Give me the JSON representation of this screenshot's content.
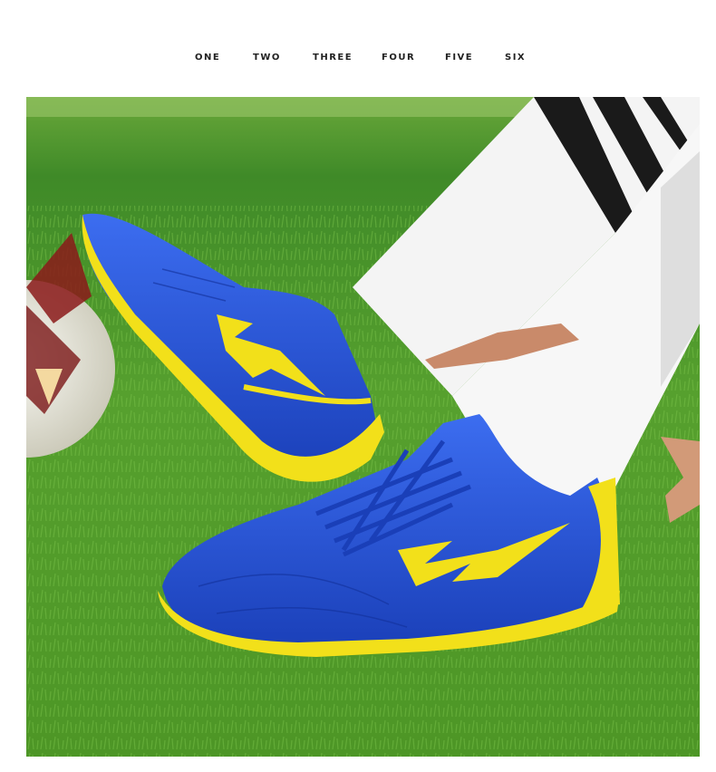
{
  "tabs": [
    {
      "label": "ONE"
    },
    {
      "label": "TWO"
    },
    {
      "label": "THREE"
    },
    {
      "label": "FOUR"
    },
    {
      "label": "FIVE"
    },
    {
      "label": "SIX"
    }
  ],
  "colors": {
    "shoe_blue": "#1f4fd8",
    "shoe_yellow": "#f2e01a",
    "grass_green": "#4f9a2a",
    "sock_white": "#f4f4f4"
  }
}
